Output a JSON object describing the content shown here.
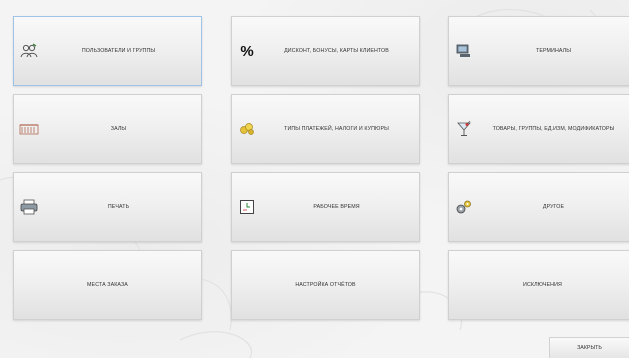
{
  "tiles": [
    {
      "label": "ПОЛЬЗОВАТЕЛИ И ГРУППЫ",
      "icon": "users-groups-icon"
    },
    {
      "label": "ДИСКОНТ, БОНУСЫ, КАРТЫ КЛИЕНТОВ",
      "icon": "percent-icon"
    },
    {
      "label": "ТЕРМИНАЛЫ",
      "icon": "terminal-icon"
    },
    {
      "label": "ЗАЛЫ",
      "icon": "halls-icon"
    },
    {
      "label": "ТИПЫ ПЛАТЕЖЕЙ, НАЛОГИ И КУПЮРЫ",
      "icon": "coins-icon"
    },
    {
      "label": "ТОВАРЫ,   ГРУППЫ, ЕД.ИЗМ, МОДИФИКАТОРЫ",
      "icon": "cocktail-icon"
    },
    {
      "label": "ПЕЧАТЬ",
      "icon": "printer-icon"
    },
    {
      "label": "РАБОЧЕЕ ВРЕМЯ",
      "icon": "clock-icon"
    },
    {
      "label": "ДРУГОЕ",
      "icon": "gears-icon"
    },
    {
      "label": "МЕСТА ЗАКАЗА"
    },
    {
      "label": "НАСТРОЙКА ОТЧЁТОВ"
    },
    {
      "label": "ИСКЛЮЧЕНИЯ"
    }
  ],
  "close_label": "ЗАКРЫТЬ",
  "colors": {
    "selected_border": "#9fc3e6",
    "tile_text": "#333333"
  }
}
